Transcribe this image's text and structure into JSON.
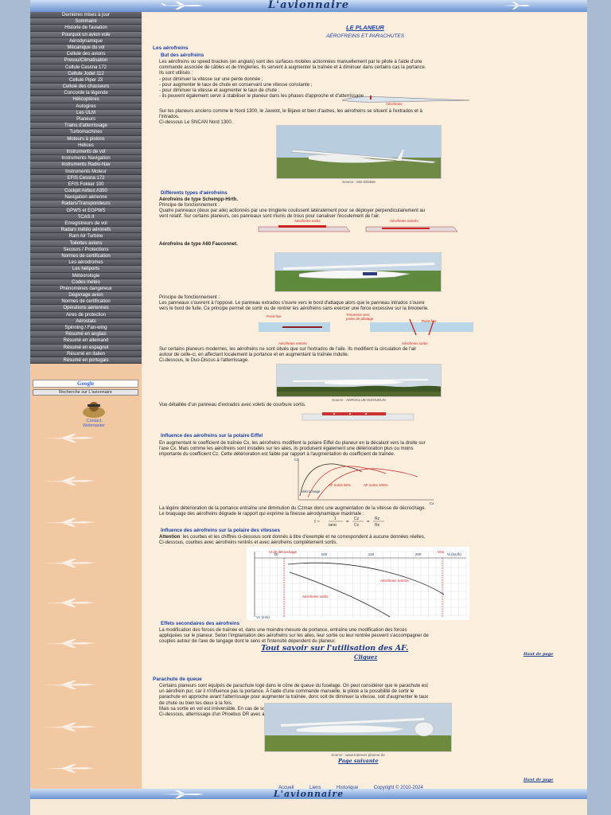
{
  "site": {
    "brand": "L'avionnaire"
  },
  "nav": [
    "Dernières mises à jour",
    "Sommaire",
    "Historie de l'aviation",
    "Pourquoi un avion vole",
    "Aérodynamique",
    "Mécanique du vol",
    "Cellule des avions",
    "Pressu/Climatisation",
    "Cellule Cessna 172",
    "Cellule Jodel 112",
    "Cellule Piper J3",
    "Cellule des chasseurs",
    "Concorde la légende",
    "Hélicoptères",
    "Autogires",
    "Les ULM",
    "Planeurs",
    "Trains d'atterrissage",
    "Turbomachines",
    "Moteurs à pistons",
    "Hélices",
    "Instruments de vol",
    "Instruments Navigation",
    "Instruments Radio-Nav",
    "Instruments Moteur",
    "EFIS Cessna 172",
    "EFIS Fokker 100",
    "Cockpit Airbus A350",
    "Navigation aérienne",
    "Radars/Transpondeurs",
    "GPWS et EGPWS",
    "TCAS II",
    "Enregistreurs de vol",
    "Radars météo aéronefs",
    "Ram Air Turbine",
    "Toilettes avions",
    "Secours / Protections",
    "Normes de certification",
    "Les aérodromes",
    "Les héliports",
    "Météorologie",
    "Codes météo",
    "Phénomènes dangereux",
    "Dégivrage avion",
    "Normes de certification",
    "Opérations aériennes",
    "Aires de protection",
    "Aérostats",
    "Spinning / Fan-wing",
    "Résumé en anglais",
    "Résumé en allemand",
    "Résumé en espagnol",
    "Résumé en italien",
    "Résumé en portugais"
  ],
  "search": {
    "google": "Google",
    "button": "Recherche sur L'avionnaire"
  },
  "contact": {
    "line1": "Contact",
    "line2": "Webmaster"
  },
  "page": {
    "title": "LE PLANEUR",
    "subtitle": "AÉROFREINS ET PARACHUTES",
    "sec1": "Les aérofreins",
    "sec1a": "But des aérofreins",
    "p1": [
      "Les aérofreins ou speed brackes (en anglais) sont des surfaces mobiles actionnées manuellement par le pilote à l'aide d'une",
      "commande associée de câbles et de tringleries. Ils servent à augmenter la traînée et à diminuer dans certains cas la portance.",
      "Ils sont utilisés :",
      "- pour diminuer la vitesse sur une pente donnée ;",
      "- pour augmenter le taux de chute en conservant une vitesse constante ;",
      "- pour diminuer la vitesse et augmenter le taux de chute ;",
      "- ils peuvent également servir à stabiliser le planeur dans les phases d'approche et d'atterrissage."
    ],
    "p2": [
      "Sur les planeurs anciens comme le Nord 1300, le Javelot, le Bijave et bien d'autres, les aérofreins se situent à l'extrados et à",
      "l'intrados.",
      "Ci-dessous Le SNCAN Nord 1300."
    ],
    "cap1": "Source : Site Ebidale",
    "sec1b": "Différents types d'aérofreins",
    "t1": "Aérofreins de type Schempp-Hirth.",
    "p3": [
      "Principe de fonctionnement :",
      "Quatre panneaux (deux par aile) actionnés par une tringlerie coulissent latéralement pour se déployer perpendiculairement au",
      "vent relatif. Sur certains planeurs, ces panneaux sont munis de trous pour canaliser l'écoulement de l'air."
    ],
    "d1a": "Aérofreins sortis",
    "d1b": "Aérofreins rentrés",
    "t2": "Aérofreins de type A60 Fauconnet.",
    "p4": [
      "Principe de fonctionnement :",
      "Les panneaux s'ouvrent à l'opposé. Le panneau extrados s'ouvre vers le bord d'attaque alors que le panneau intrados s'ouvre",
      "vers le bord de fuite. Ce principe permet de sortir ou de rentrer les aérofreins sans exercer une force excessive sur la timonerie."
    ],
    "d2": [
      "Point fixe",
      "Timonerie vers",
      "poste de pilotage",
      "Point fixe",
      "Aérofreins rentrés",
      "Aérofreins sortis"
    ],
    "p5": [
      "Sur certains planeurs modernes, les aérofreins ne sont situés que sur l'extrados de l'aile. Ils modifient la circulation de l'air",
      "autour de celle-ci, en affectant localement la portance et en augmentant la traînée induite.",
      "Ci-dessous, le Duo-Discus à l'atterrissage."
    ],
    "cap2": "Source : AÉROCLUB ISSOUDUN",
    "p6": "Vue détaillée d'un panneau d'extrados avec volets de courbure sortis.",
    "sec1c": "Influence des aérofreins sur la polaire Eiffel",
    "p7": [
      "En augmentant le coefficient de traînée Cx, les aérofreins modifient la polaire Eiffel du planeur en la décalant vers la droite sur",
      "l'axe Cx. Mais comme les aérofreins sont installés sur les ailes, ils produisent également une détérioration plus ou moins",
      "importante du coefficient Cz. Cette détérioration est faible par rapport à l'augmentation du coefficient de traînée."
    ],
    "p8": [
      "La légère détérioration de la portance entraîne une diminution du Czmax donc une augmentation de la vitesse de décrochage.",
      "Le braquage des aérofreins dégrade le rapport qui exprime la finesse aérodynamique maximale :"
    ],
    "sec1d": "Influence des aérofreins sur la polaire des vitesses",
    "p9a": "Attention",
    "p9": [
      ": les courbes et les chiffres ci-dessous sont donnés à titre d'exemple et ne correspondent à aucune données réelles.",
      "Ci-dessous, courbes avec aérofreins rentrés et avec aérofreins complètement sortis."
    ],
    "sec1e": "Effets secondaires des aérofreins",
    "p10": [
      "La modification des forces de traînée et, dans une moindre mesure de portance, entraîne une modification des forces",
      "appliquées sur le planeur. Selon l'implantation des aérofreins sur les ailes, leur sortie ou leur rentrée peuvent s'accompagner de",
      "couples autour de l'axe de tangage dont le sens et l'intensité dépendent du planeur."
    ],
    "link1": "Tout savoir sur l'utilisation des AF.",
    "link1b": "Cliquez",
    "top_label": "Haut de page",
    "sec2": "Parachute de queue",
    "p11": [
      "Certains planeurs sont équipés de parachute logé dans le cône de queue du fuselage. On peut considérer que le parachute est",
      "un aérofrein pur, car il n'influence pas la portance. À l'aide d'une commande manuelle, le pilote a la possibilité de sortir le",
      "parachute en approche avant l'atterrissage pour augmenter la traînée, donc soit de diminuer la vitesse, soit d'augmenter le taux",
      "de chute ou bien les deux à la fois.",
      "Mais sa sortie en vol est irréversible. En cas de sortie involontaire du parachute, le pilote a la possibilité de le larguer.",
      "Ci-dessous, atterrissage d'un Phoebus DR avec aérofreins et parachute de queue sortis."
    ],
    "cap3": "Source : www.traiteurs-planeur.de",
    "next": "Page suivante"
  },
  "chart_data": [
    {
      "type": "line",
      "title": "",
      "xlabel": "Cx",
      "ylabel": "Cz",
      "annotations": [
        "AF rentrés",
        "AF sortis 50%",
        "AF sortis 100%",
        "décrochage"
      ]
    },
    {
      "type": "line",
      "title": "",
      "xlabel": "Vi (km/h)",
      "ylabel": "Vz (m/s)",
      "x_ticks": [
        50,
        100,
        150,
        200
      ],
      "annotations": [
        "Vi de décrochage",
        "Vne",
        "Aérofreins rentrés",
        "Aérofreins sortis"
      ]
    }
  ],
  "footer": {
    "links": [
      "Accueil",
      "Liens",
      "Historique",
      "Copyright © 2010-2024"
    ]
  }
}
